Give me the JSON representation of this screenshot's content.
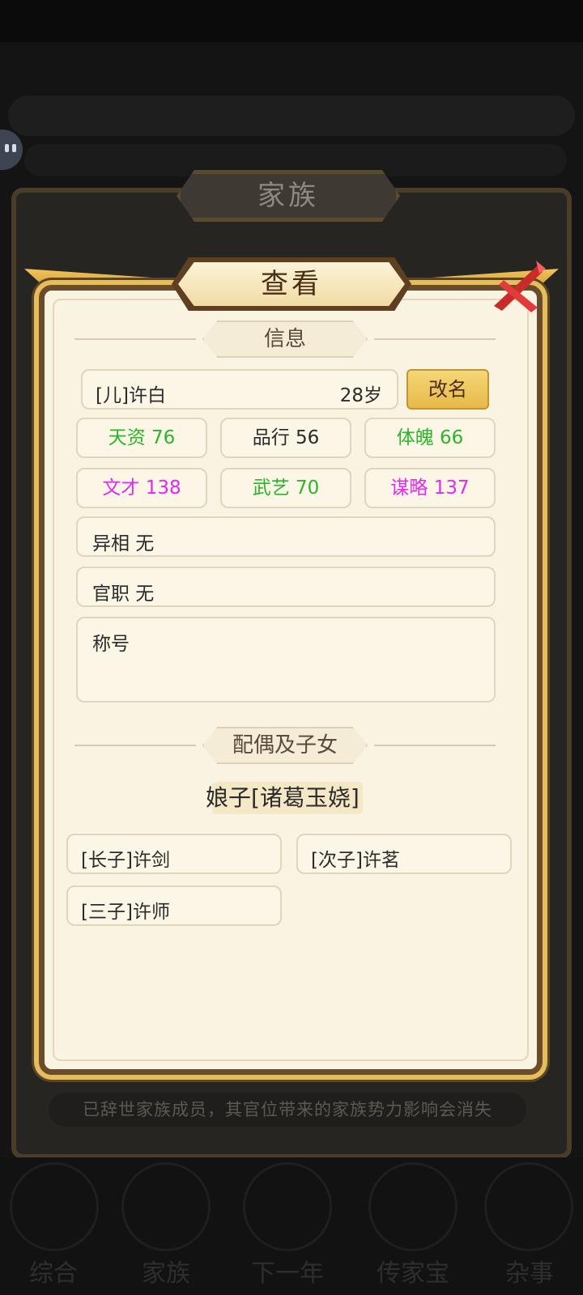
{
  "background": {
    "panel_title": "家族",
    "notice": "已辞世家族成员，其官位带来的家族势力影响会消失",
    "nav": [
      "综合",
      "家族",
      "下一年",
      "传家宝",
      "杂事"
    ]
  },
  "dialog": {
    "title": "查看",
    "info_section": "信息",
    "person": {
      "name": "[儿]许白",
      "age": "28岁"
    },
    "rename_label": "改名",
    "stats": [
      {
        "text": "天资 76",
        "color": "#2bb52b"
      },
      {
        "text": "品行 56",
        "color": "#2b2b2b"
      },
      {
        "text": "体魄 66",
        "color": "#2bb52b"
      },
      {
        "text": "文才 138",
        "color": "#e329ef"
      },
      {
        "text": "武艺 70",
        "color": "#2bb52b"
      },
      {
        "text": "谋略 137",
        "color": "#e329ef"
      }
    ],
    "yixiang": "异相 无",
    "guanzhi": "官职 无",
    "chenghao": "称号",
    "family_section": "配偶及子女",
    "spouse": "娘子[诸葛玉娆]",
    "children": [
      "[长子]许剑",
      "[次子]许茗",
      "[三子]许师"
    ]
  }
}
